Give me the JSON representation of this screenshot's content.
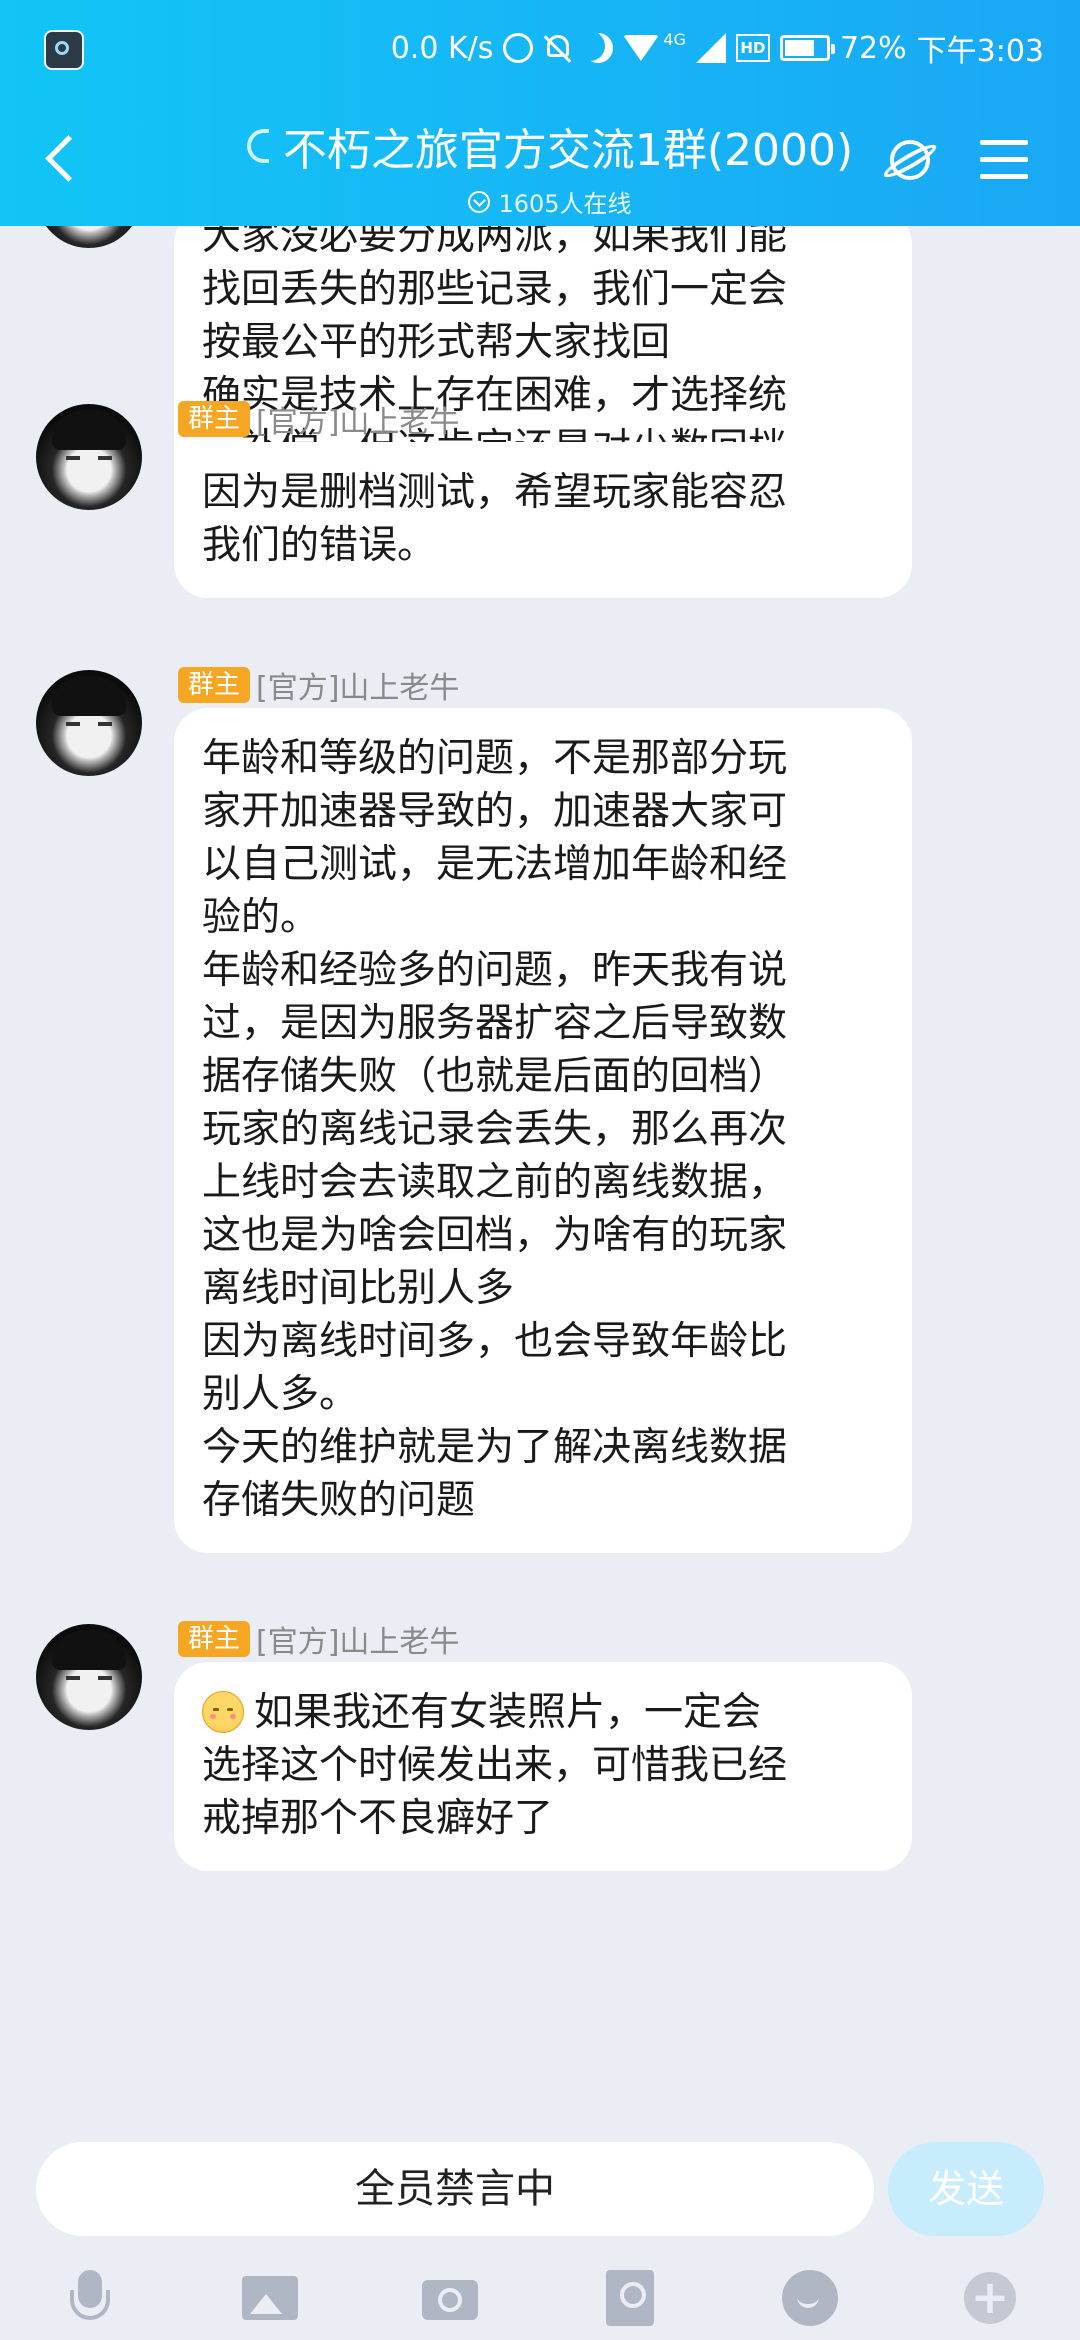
{
  "status_bar": {
    "speed": "0.0 K/s",
    "network": "4G",
    "hd_label": "HD",
    "battery_percent": "72%",
    "battery_level": 0.72,
    "time": "下午3:03"
  },
  "header": {
    "title": "不朽之旅官方交流1群(2000)",
    "online": "1605人在线"
  },
  "messages": [
    {
      "text": "大家没必要分成两派，如果我们能\n找回丢失的那些记录，我们一定会\n按最公平的形式帮大家找回\n确实是技术上存在困难，才选择统\n一补偿，但这肯定还是对少数回档\n的玩家不公平的"
    },
    {
      "role": "群主",
      "sender": "[官方]山上老牛",
      "text": "因为是删档测试，希望玩家能容忍\n我们的错误。"
    },
    {
      "role": "群主",
      "sender": "[官方]山上老牛",
      "text": "年龄和等级的问题，不是那部分玩\n家开加速器导致的，加速器大家可\n以自己测试，是无法增加年龄和经\n验的。\n年龄和经验多的问题，昨天我有说\n过，是因为服务器扩容之后导致数\n据存储失败（也就是后面的回档）\n玩家的离线记录会丢失，那么再次\n上线时会去读取之前的离线数据，\n这也是为啥会回档，为啥有的玩家\n离线时间比别人多\n因为离线时间多，也会导致年龄比\n别人多。\n今天的维护就是为了解决离线数据\n存储失败的问题"
    },
    {
      "role": "群主",
      "sender": "[官方]山上老牛",
      "emoji": "blush-emoji",
      "text": "如果我还有女装照片，一定会\n选择这个时候发出来，可惜我已经\n戒掉那个不良癖好了"
    }
  ],
  "input": {
    "mute_text": "全员禁言中",
    "send_label": "发送"
  },
  "toolbar": {
    "icons": [
      "mic-icon",
      "image-icon",
      "camera-icon",
      "red-packet-icon",
      "emoji-icon",
      "plus-icon"
    ]
  },
  "colors": {
    "header_gradient_start": "#12c5f6",
    "header_gradient_end": "#1aa8f5",
    "chat_background": "#ebedf5",
    "role_badge": "#f5a623",
    "send_button_disabled": "#c7ecfb"
  }
}
